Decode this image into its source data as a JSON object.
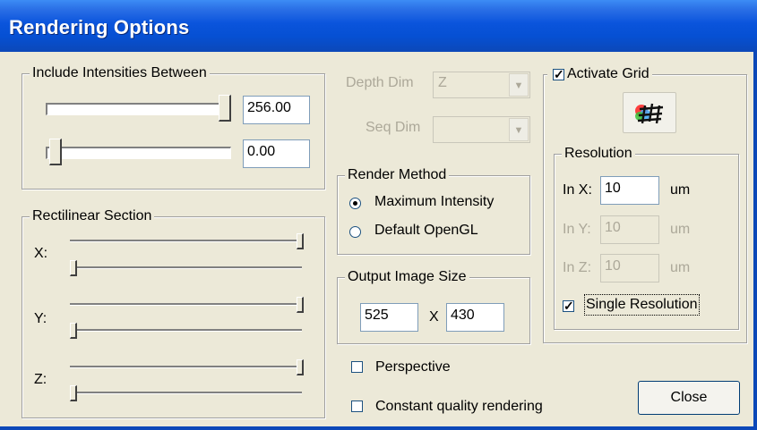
{
  "window": {
    "title": "Rendering Options"
  },
  "intensities": {
    "legend": "Include Intensities Between",
    "upper_value": "256.00",
    "lower_value": "0.00",
    "upper_slider_fraction": 1.0,
    "lower_slider_fraction": 0.0
  },
  "dims": {
    "depth_label": "Depth Dim",
    "depth_value": "Z",
    "seq_label": "Seq Dim",
    "seq_value": ""
  },
  "render_method": {
    "legend": "Render Method",
    "options": [
      "Maximum Intensity",
      "Default OpenGL"
    ],
    "selected": "Maximum Intensity"
  },
  "output_size": {
    "legend": "Output Image Size",
    "width": "525",
    "separator": "X",
    "height": "430"
  },
  "rectilinear": {
    "legend": "Rectilinear Section",
    "x_label": "X:",
    "y_label": "Y:",
    "z_label": "Z:"
  },
  "grid": {
    "activate_label": "Activate Grid",
    "activate_checked": true,
    "resolution_legend": "Resolution",
    "in_x_label": "In X:",
    "in_x_value": "10",
    "in_x_unit": "um",
    "in_y_label": "In Y:",
    "in_y_value": "10",
    "in_y_unit": "um",
    "in_z_label": "In Z:",
    "in_z_value": "10",
    "in_z_unit": "um",
    "single_resolution_label": "Single Resolution",
    "single_resolution_checked": true
  },
  "options": {
    "perspective_label": "Perspective",
    "perspective_checked": false,
    "constant_quality_label": "Constant quality rendering",
    "constant_quality_checked": false
  },
  "buttons": {
    "close_label": "Close"
  },
  "colors": {
    "title_bar": "#0a54dc",
    "dialog_bg": "#ece9d8",
    "disabled_text": "#aca899"
  }
}
